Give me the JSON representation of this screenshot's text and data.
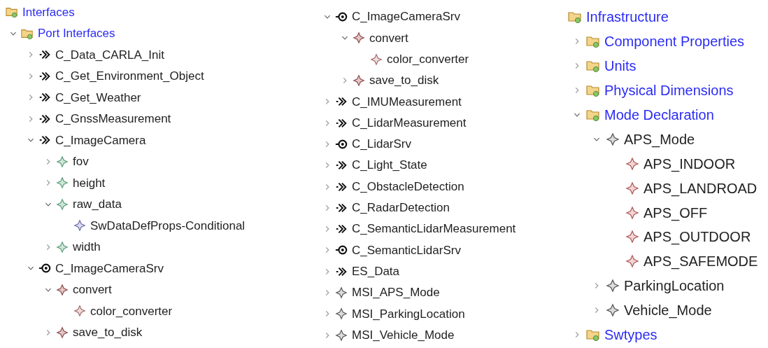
{
  "panels": [
    {
      "header": {
        "label": "Interfaces",
        "kind": "folder"
      },
      "items": [
        {
          "label": "Port Interfaces",
          "kind": "folder",
          "expanded": true,
          "children": [
            {
              "label": "C_Data_CARLA_Init",
              "kind": "sender_receiver",
              "expanded": false
            },
            {
              "label": "C_Get_Environment_Object",
              "kind": "sender_receiver",
              "expanded": false
            },
            {
              "label": "C_Get_Weather",
              "kind": "sender_receiver",
              "expanded": false
            },
            {
              "label": "C_GnssMeasurement",
              "kind": "sender_receiver",
              "expanded": false
            },
            {
              "label": "C_ImageCamera",
              "kind": "sender_receiver",
              "expanded": true,
              "children": [
                {
                  "label": "fov",
                  "kind": "data_element",
                  "expanded": false
                },
                {
                  "label": "height",
                  "kind": "data_element",
                  "expanded": false
                },
                {
                  "label": "raw_data",
                  "kind": "data_element",
                  "expanded": true,
                  "children": [
                    {
                      "label": "SwDataDefProps-Conditional",
                      "kind": "props"
                    }
                  ]
                },
                {
                  "label": "width",
                  "kind": "data_element",
                  "expanded": false
                }
              ]
            },
            {
              "label": "C_ImageCameraSrv",
              "kind": "client_server",
              "expanded": true,
              "children": [
                {
                  "label": "convert",
                  "kind": "operation",
                  "expanded": true,
                  "children": [
                    {
                      "label": "color_converter",
                      "kind": "argument"
                    }
                  ]
                },
                {
                  "label": "save_to_disk",
                  "kind": "operation",
                  "expanded": false
                }
              ]
            }
          ]
        }
      ]
    },
    {
      "items": [
        {
          "label": "C_ImageCameraSrv",
          "kind": "client_server",
          "expanded": true,
          "children": [
            {
              "label": "convert",
              "kind": "operation",
              "expanded": true,
              "children": [
                {
                  "label": "color_converter",
                  "kind": "argument"
                }
              ]
            },
            {
              "label": "save_to_disk",
              "kind": "operation",
              "expanded": false
            }
          ]
        },
        {
          "label": "C_IMUMeasurement",
          "kind": "sender_receiver",
          "expanded": false
        },
        {
          "label": "C_LidarMeasurement",
          "kind": "sender_receiver",
          "expanded": false
        },
        {
          "label": "C_LidarSrv",
          "kind": "client_server",
          "expanded": false
        },
        {
          "label": "C_Light_State",
          "kind": "sender_receiver",
          "expanded": false
        },
        {
          "label": "C_ObstacleDetection",
          "kind": "sender_receiver",
          "expanded": false
        },
        {
          "label": "C_RadarDetection",
          "kind": "sender_receiver",
          "expanded": false
        },
        {
          "label": "C_SemanticLidarMeasurement",
          "kind": "sender_receiver",
          "expanded": false
        },
        {
          "label": "C_SemanticLidarSrv",
          "kind": "client_server",
          "expanded": false
        },
        {
          "label": "ES_Data",
          "kind": "sender_receiver",
          "expanded": false
        },
        {
          "label": "MSI_APS_Mode",
          "kind": "mode_group",
          "expanded": false
        },
        {
          "label": "MSI_ParkingLocation",
          "kind": "mode_group",
          "expanded": false
        },
        {
          "label": "MSI_Vehicle_Mode",
          "kind": "mode_group",
          "expanded": false
        }
      ]
    },
    {
      "header": {
        "label": "Infrastructure",
        "kind": "folder"
      },
      "items": [
        {
          "label": "Component Properties",
          "kind": "folder",
          "expanded": false
        },
        {
          "label": "Units",
          "kind": "folder",
          "expanded": false
        },
        {
          "label": "Physical Dimensions",
          "kind": "folder",
          "expanded": false
        },
        {
          "label": "Mode Declaration",
          "kind": "folder",
          "expanded": true,
          "children": [
            {
              "label": "APS_Mode",
              "kind": "mode_group",
              "expanded": true,
              "children": [
                {
                  "label": "APS_INDOOR",
                  "kind": "mode"
                },
                {
                  "label": "APS_LANDROAD",
                  "kind": "mode"
                },
                {
                  "label": "APS_OFF",
                  "kind": "mode"
                },
                {
                  "label": "APS_OUTDOOR",
                  "kind": "mode"
                },
                {
                  "label": "APS_SAFEMODE",
                  "kind": "mode"
                }
              ]
            },
            {
              "label": "ParkingLocation",
              "kind": "mode_group",
              "expanded": false
            },
            {
              "label": "Vehicle_Mode",
              "kind": "mode_group",
              "expanded": false
            }
          ]
        },
        {
          "label": "Swtypes",
          "kind": "folder",
          "expanded": false
        }
      ]
    }
  ]
}
